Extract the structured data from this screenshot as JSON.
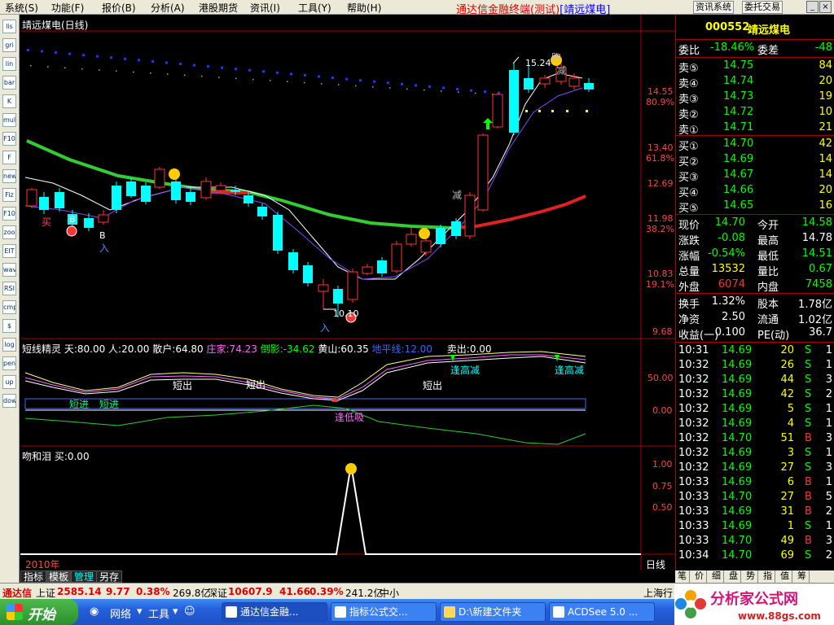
{
  "menu": {
    "items": [
      "系统(S)",
      "功能(F)",
      "报价(B)",
      "分析(A)",
      "港股期货",
      "资讯(I)",
      "工具(Y)",
      "帮助(H)"
    ],
    "app_title": "通达信金融终端(测试)",
    "stock_window": "[靖远煤电]",
    "buttons": [
      "资讯系统",
      "委托交易"
    ]
  },
  "left_toolbar": [
    "list",
    "grid",
    "line",
    "bar",
    "K",
    "multi",
    "F10",
    "F",
    "news",
    "Fiz",
    "F10b",
    "zoom",
    "EIT",
    "wave",
    "RSI",
    "cmp",
    "$",
    "login",
    "pencil",
    "up",
    "down"
  ],
  "main_chart": {
    "title": "靖远煤电(日线)",
    "price_labels": [
      "14.55",
      "13.40",
      "12.69",
      "11.98",
      "10.83",
      "9.68"
    ],
    "pct_labels": [
      "80.9%",
      "61.8%",
      "38.2%",
      "19.1%"
    ],
    "annotations": {
      "peak": "15.24",
      "low": "10.10",
      "buy": "买",
      "b1": "B",
      "b2": "B",
      "ru1": "入",
      "ru2": "入",
      "jian1": "减",
      "jian2": "减",
      "pao": "跑"
    }
  },
  "indicator1": {
    "legend": [
      {
        "text": "短线精灵 天:80.00",
        "color": "#ffffff"
      },
      {
        "text": "人:20.00",
        "color": "#ffffff"
      },
      {
        "text": "散户:64.80",
        "color": "#ffffff"
      },
      {
        "text": "庄家:74.23",
        "color": "#ff66ff"
      },
      {
        "text": "倒影:-34.62",
        "color": "#00ff00"
      },
      {
        "text": "黄山:60.35",
        "color": "#ffffff"
      },
      {
        "text": "地平线:12.00",
        "color": "#3366ff"
      },
      {
        "text": "卖出:0.00",
        "color": "#ffffff"
      }
    ],
    "scale": [
      "50.00",
      "0.00"
    ],
    "labels": {
      "duanchu1": "短出",
      "duanchu2": "短出",
      "duanchu3": "短出",
      "duanjin1": "短进",
      "duanjin2": "短进",
      "fengao1": "逢高减",
      "fengao2": "逢高减",
      "fengdi": "逢低吸"
    }
  },
  "indicator2": {
    "legend": "吻和泪 买:0.00",
    "scale": [
      "1.00",
      "0.75",
      "0.50"
    ],
    "peak_value": 1.0,
    "baseline_value": 0.0
  },
  "bottom": {
    "year": "2010年",
    "period": "日线",
    "tabs": [
      "指标",
      "模板",
      "管理",
      "另存"
    ],
    "right_tabs": [
      "笔",
      "价",
      "细",
      "盘",
      "势",
      "指",
      "值",
      "筹"
    ]
  },
  "quote": {
    "code": "000552",
    "name": "靖远煤电",
    "weibi_label": "委比",
    "weibi": "-18.46%",
    "weicha_label": "委差",
    "weicha": "-48",
    "sells": [
      {
        "label": "卖⑤",
        "price": "14.75",
        "vol": "84"
      },
      {
        "label": "卖④",
        "price": "14.74",
        "vol": "20"
      },
      {
        "label": "卖③",
        "price": "14.73",
        "vol": "19"
      },
      {
        "label": "卖②",
        "price": "14.72",
        "vol": "10"
      },
      {
        "label": "卖①",
        "price": "14.71",
        "vol": "21"
      }
    ],
    "buys": [
      {
        "label": "买①",
        "price": "14.70",
        "vol": "42"
      },
      {
        "label": "买②",
        "price": "14.69",
        "vol": "14"
      },
      {
        "label": "买③",
        "price": "14.67",
        "vol": "14"
      },
      {
        "label": "买④",
        "price": "14.66",
        "vol": "20"
      },
      {
        "label": "买⑤",
        "price": "14.65",
        "vol": "16"
      }
    ],
    "stats": [
      [
        {
          "l": "现价",
          "v": "14.70",
          "c": "#00ff00"
        },
        {
          "l": "今开",
          "v": "14.58",
          "c": "#00ff00"
        }
      ],
      [
        {
          "l": "涨跌",
          "v": "-0.08",
          "c": "#00ff00"
        },
        {
          "l": "最高",
          "v": "14.78",
          "c": "#ffffff"
        }
      ],
      [
        {
          "l": "涨幅",
          "v": "-0.54%",
          "c": "#00ff00"
        },
        {
          "l": "最低",
          "v": "14.51",
          "c": "#00ff00"
        }
      ],
      [
        {
          "l": "总量",
          "v": "13532",
          "c": "#ffff00"
        },
        {
          "l": "量比",
          "v": "0.67",
          "c": "#00ff00"
        }
      ],
      [
        {
          "l": "外盘",
          "v": "6074",
          "c": "#ff3333"
        },
        {
          "l": "内盘",
          "v": "7458",
          "c": "#00ff00"
        }
      ]
    ],
    "stats2": [
      [
        {
          "l": "换手",
          "v": "1.32%"
        },
        {
          "l": "股本",
          "v": "1.78亿"
        }
      ],
      [
        {
          "l": "净资",
          "v": "2.50"
        },
        {
          "l": "流通",
          "v": "1.02亿"
        }
      ],
      [
        {
          "l": "收益(一)",
          "v": "0.100"
        },
        {
          "l": "PE(动)",
          "v": "36.7"
        }
      ]
    ],
    "ticks": [
      {
        "t": "10:31",
        "p": "14.69",
        "v": "20",
        "s": "S",
        "n": "1"
      },
      {
        "t": "10:32",
        "p": "14.69",
        "v": "26",
        "s": "S",
        "n": "1"
      },
      {
        "t": "10:32",
        "p": "14.69",
        "v": "44",
        "s": "S",
        "n": "3"
      },
      {
        "t": "10:32",
        "p": "14.69",
        "v": "42",
        "s": "S",
        "n": "2"
      },
      {
        "t": "10:32",
        "p": "14.69",
        "v": "5",
        "s": "S",
        "n": "1"
      },
      {
        "t": "10:32",
        "p": "14.69",
        "v": "4",
        "s": "S",
        "n": "1"
      },
      {
        "t": "10:32",
        "p": "14.70",
        "v": "51",
        "s": "B",
        "n": "3"
      },
      {
        "t": "10:32",
        "p": "14.69",
        "v": "3",
        "s": "S",
        "n": "1"
      },
      {
        "t": "10:32",
        "p": "14.69",
        "v": "27",
        "s": "S",
        "n": "3"
      },
      {
        "t": "10:33",
        "p": "14.69",
        "v": "6",
        "s": "B",
        "n": "1"
      },
      {
        "t": "10:33",
        "p": "14.70",
        "v": "27",
        "s": "B",
        "n": "5"
      },
      {
        "t": "10:33",
        "p": "14.69",
        "v": "31",
        "s": "B",
        "n": "2"
      },
      {
        "t": "10:33",
        "p": "14.69",
        "v": "1",
        "s": "S",
        "n": "1"
      },
      {
        "t": "10:33",
        "p": "14.70",
        "v": "49",
        "s": "B",
        "n": "3"
      },
      {
        "t": "10:34",
        "p": "14.70",
        "v": "69",
        "s": "S",
        "n": "2"
      }
    ]
  },
  "status": {
    "brand": "通达信",
    "sh_label": "上证",
    "sh_val": "2585.14",
    "sh_chg": "9.77",
    "sh_pct": "0.38%",
    "sh_amt": "269.8亿",
    "sz_label": "深证",
    "sz_val": "10607.9",
    "sz_chg": "41.66",
    "sz_pct": "0.39%",
    "sz_amt": "241.2亿",
    "extra": "中小",
    "right": "上海行"
  },
  "taskbar": {
    "start": "开始",
    "network": "网络",
    "tools": "工具",
    "tasks": [
      "通达信金融...",
      "指标公式交...",
      "D:\\新建文件夹",
      "ACDSee 5.0 ..."
    ],
    "brand_text": "分析家公式网",
    "brand_url": "www.88gs.com"
  },
  "colors": {
    "up": "#ff3333",
    "down": "#00ffff",
    "ma_green": "#33cc33",
    "ma_red": "#dd2222",
    "blue_dots": "#2233ff",
    "yellow_dots": "#ffff00",
    "accent_red": "#aa0000"
  }
}
